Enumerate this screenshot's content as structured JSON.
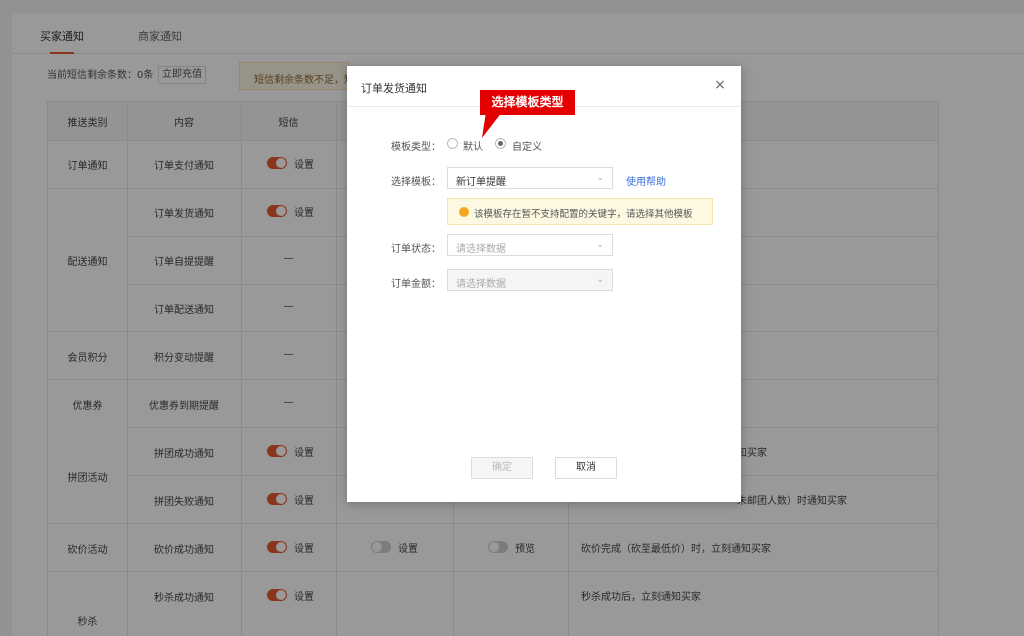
{
  "tabs": [
    "买家通知",
    "商家通知"
  ],
  "sms": {
    "remaining_label": "当前短信剩余条数：0条",
    "recharge_label": "立即充值",
    "warning": "短信剩余条数不足，短"
  },
  "table": {
    "headers": [
      "推送类别",
      "内容",
      "短信"
    ],
    "categories": [
      "订单通知",
      "配送通知",
      "会员积分",
      "优惠券",
      "拼团活动",
      "砍价活动",
      "秒杀"
    ],
    "contents": [
      "订单支付通知",
      "订单发货通知",
      "订单自提提醒",
      "订单配送通知",
      "积分变动提醒",
      "优惠券到期提醒",
      "拼团成功通知",
      "拼团失败通知",
      "砍价成功通知",
      "秒杀成功通知"
    ],
    "sms_cells": [
      "设置",
      "设置",
      "—",
      "—",
      "—",
      "—",
      "设置",
      "设置",
      "设置",
      "设置"
    ],
    "wechat_label": "设置",
    "app_label": "预览",
    "desc_fragments": [
      "知买家",
      "未邮团人数）时通知买家",
      "砍价完成（砍至最低价）时，立刻通知买家",
      "秒杀成功后，立刻通知买家"
    ]
  },
  "dialog": {
    "title": "订单发货通知",
    "close_icon": "×",
    "template_type_label": "模板类型：",
    "radio_default": "默认",
    "radio_custom": "自定义",
    "choose_template_label": "选择模板：",
    "template_value": "新订单提醒",
    "help_link": "使用帮助",
    "tip": "该模板存在暂不支持配置的关键字，请选择其他模板",
    "order_status_label": "订单状态：",
    "order_status_placeholder": "请选择数据",
    "order_amount_label": "订单金额：",
    "order_amount_placeholder": "请选择数据",
    "confirm_label": "确定",
    "cancel_label": "取消"
  },
  "annotation": {
    "text": "选择模板类型"
  },
  "colors": {
    "accent": "#e4572e",
    "callout": "#e40000",
    "link": "#3a6fd8"
  }
}
